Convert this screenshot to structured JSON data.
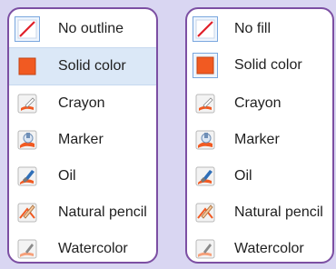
{
  "left_menu": {
    "items": [
      {
        "label": "No outline",
        "icon": "no-outline-icon"
      },
      {
        "label": "Solid color",
        "icon": "solid-color-icon"
      },
      {
        "label": "Crayon",
        "icon": "crayon-icon"
      },
      {
        "label": "Marker",
        "icon": "marker-icon"
      },
      {
        "label": "Oil",
        "icon": "oil-icon"
      },
      {
        "label": "Natural pencil",
        "icon": "natural-pencil-icon"
      },
      {
        "label": "Watercolor",
        "icon": "watercolor-icon"
      }
    ]
  },
  "right_menu": {
    "items": [
      {
        "label": "No fill",
        "icon": "no-fill-icon"
      },
      {
        "label": "Solid color",
        "icon": "solid-color-icon"
      },
      {
        "label": "Crayon",
        "icon": "crayon-icon"
      },
      {
        "label": "Marker",
        "icon": "marker-icon"
      },
      {
        "label": "Oil",
        "icon": "oil-icon"
      },
      {
        "label": "Natural pencil",
        "icon": "natural-pencil-icon"
      },
      {
        "label": "Watercolor",
        "icon": "watercolor-icon"
      }
    ]
  },
  "colors": {
    "background": "#d9d6f2",
    "panel_border": "#7c4fa3",
    "accent_orange": "#f15a22",
    "no_fill_red": "#e0202a",
    "selection": "#dbe8f7"
  }
}
